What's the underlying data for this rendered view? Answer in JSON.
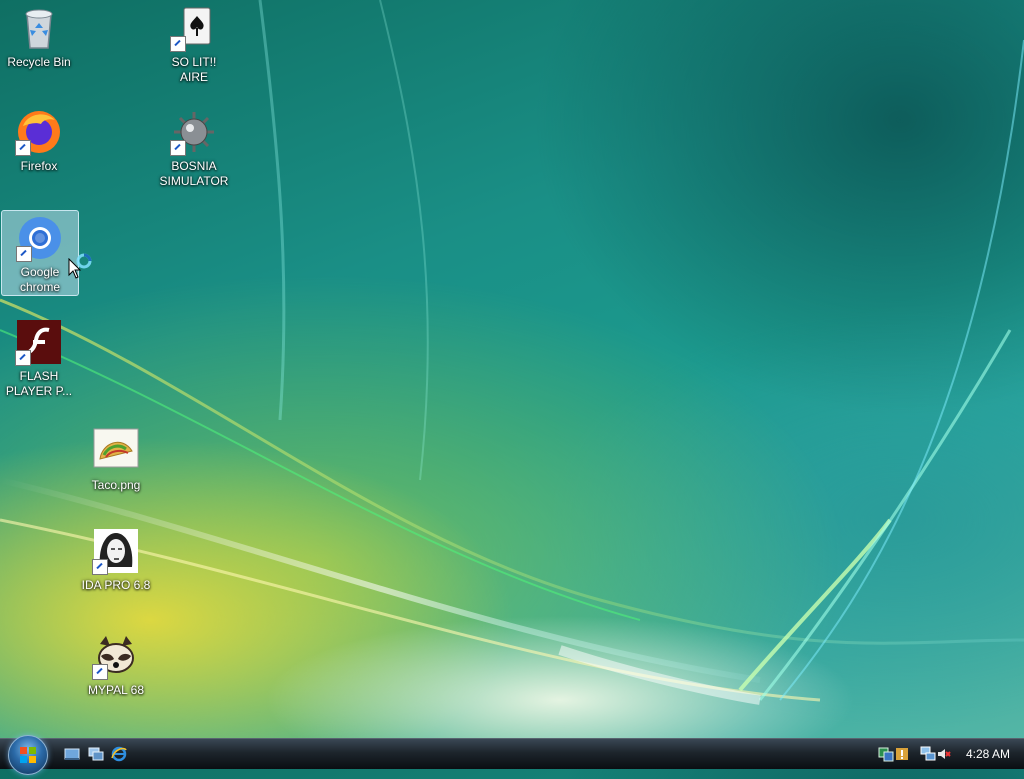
{
  "desktop": {
    "icons": [
      {
        "label": "Recycle Bin",
        "icon": "recycle-bin-icon"
      },
      {
        "label": "SO LIT!! AIRE",
        "icon": "solitaire-icon"
      },
      {
        "label": "Firefox",
        "icon": "firefox-icon"
      },
      {
        "label": "BOSNIA SIMULATOR",
        "icon": "minesweeper-icon"
      },
      {
        "label": "Google chrome",
        "icon": "chrome-icon"
      },
      {
        "label": "FLASH PLAYER P...",
        "icon": "flash-player-icon"
      },
      {
        "label": "Taco.png",
        "icon": "taco-image-icon"
      },
      {
        "label": "IDA PRO 6.8",
        "icon": "ida-pro-icon"
      },
      {
        "label": "MYPAL 68",
        "icon": "mypal-icon"
      }
    ]
  },
  "taskbar": {
    "start": "start-orb",
    "quick_launch": [
      "show-desktop-icon",
      "switch-windows-icon",
      "internet-explorer-icon"
    ],
    "tray_icons": [
      "network-icon",
      "security-alert-icon",
      "network-connection-icon",
      "volume-muted-icon"
    ],
    "clock": "4:28 AM"
  },
  "colors": {
    "accent": "#2aa6a0",
    "taskbar": "#1d252c",
    "selection": "#bedcea"
  }
}
